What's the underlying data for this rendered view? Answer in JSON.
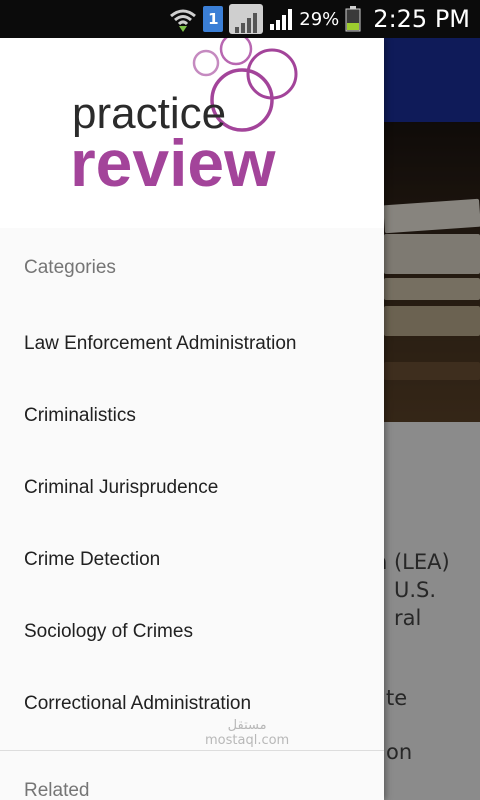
{
  "status_bar": {
    "time": "2:25 PM",
    "battery_percent": "29%",
    "sim_slot": "1",
    "icons": [
      "wifi-icon",
      "sim-icon",
      "signal-box-icon",
      "cell-signal-icon",
      "battery-icon"
    ]
  },
  "background_app": {
    "toolbar_color": "#1a2f9a",
    "body_lines": [
      "n (LEA)",
      "U.S.",
      "ral",
      "te",
      "on"
    ]
  },
  "drawer": {
    "logo": {
      "line1": "practice",
      "line2": "review"
    },
    "categories_header": "Categories",
    "categories": [
      "Law Enforcement Administration",
      "Criminalistics",
      "Criminal Jurisprudence",
      "Crime Detection",
      "Sociology of Crimes",
      "Correctional Administration"
    ],
    "related_header": "Related"
  },
  "watermark": {
    "line1": "مستقل",
    "line2": "mostaql.com"
  },
  "colors": {
    "brand_purple": "#a3449a",
    "logo_dark": "#2b2b2b",
    "drawer_bg": "#fafafa",
    "status_bar": "#0b0b0b"
  }
}
